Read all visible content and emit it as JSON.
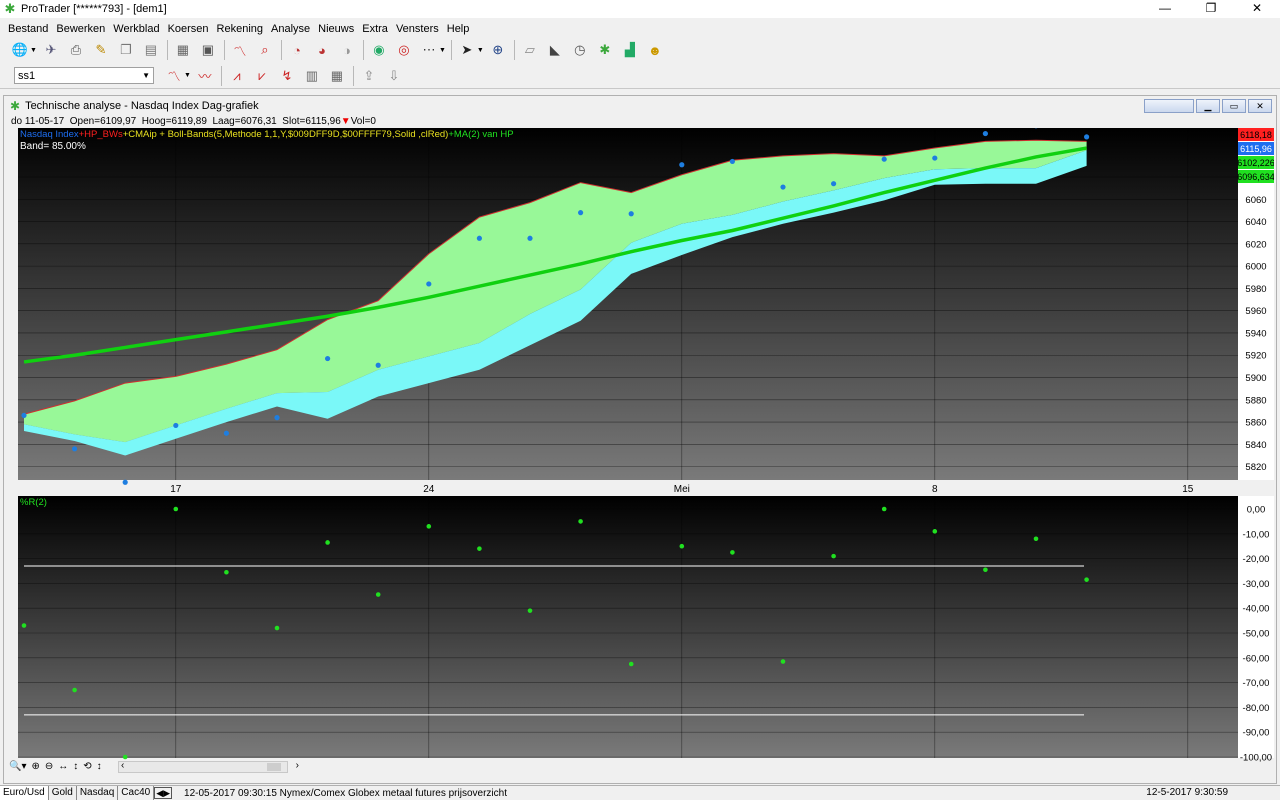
{
  "window": {
    "title": "ProTrader [******793] - [dem1]",
    "controls": [
      "—",
      "❐",
      "✕"
    ]
  },
  "menu": [
    {
      "label": "Bestand"
    },
    {
      "label": "Bewerken"
    },
    {
      "label": "Werkblad"
    },
    {
      "label": "Koersen"
    },
    {
      "label": "Rekening"
    },
    {
      "label": "Analyse"
    },
    {
      "label": "Nieuws"
    },
    {
      "label": "Extra"
    },
    {
      "label": "Vensters"
    },
    {
      "label": "Help"
    }
  ],
  "toolbar": {
    "sheet_value": "ss1"
  },
  "document": {
    "title": "Technische analyse -   Nasdaq Index Dag-grafiek",
    "quote": {
      "date": "do 11-05-17",
      "open": "Open=6109,97",
      "high": "Hoog=6119,89",
      "low": "Laag=6076,31",
      "close": "Slot=6115,96",
      "vol": "Vol=0"
    }
  },
  "colors": {
    "band_upper_fill": "#98f898",
    "band_lower_fill": "#7af8f8",
    "ma_line": "#10d010",
    "price_dot": "#1e7ee0",
    "r_dot": "#20e020",
    "label_red": "#ff2020",
    "label_blue": "#1e6ef0",
    "label_green": "#20e020"
  },
  "legend": {
    "nasdaq": "Nasdaq Index",
    "hp": "+HP_BWs",
    "cmaip": "+CMAip + Boll-Bands(5,Methode 1,1,Y,$009DFF9D,$00FFFF79,Solid     ,clRed)",
    "ma": "+MA(2) van HP",
    "band": "Band= 85.00%"
  },
  "lower_legend": "%R(2)",
  "last_labels": [
    "6118,18",
    "6115,96",
    "6102,226",
    "6096,634"
  ],
  "chart_data": [
    {
      "type": "line",
      "title": "Nasdaq Index Dag-grafiek",
      "x_ticks": [
        "17",
        "24",
        "Mei",
        "8",
        "15"
      ],
      "y_ticks": [
        6080,
        6060,
        6040,
        6020,
        6000,
        5980,
        5960,
        5940,
        5920,
        5900,
        5880,
        5860,
        5840,
        5820
      ],
      "ylim": [
        5808,
        6124
      ],
      "series": [
        {
          "name": "Nasdaq Index",
          "values": [
            5866,
            5836,
            5806,
            5857,
            5850,
            5864,
            5917,
            5911,
            5984,
            6025,
            6025,
            6048,
            6047,
            6091,
            6094,
            6071,
            6074,
            6096,
            6097,
            6119,
            6126,
            6116
          ]
        },
        {
          "name": "HP_BWs",
          "values": [
            5867,
            5879,
            5895,
            5901,
            5912,
            5925,
            5952,
            5969,
            6011,
            6044,
            6057,
            6075,
            6066,
            6082,
            6095,
            6099,
            6101,
            6099,
            6106,
            6112,
            6113,
            6112
          ]
        },
        {
          "name": "CMAip",
          "values": [
            5858,
            5849,
            5842,
            5857,
            5872,
            5886,
            5887,
            5907,
            5919,
            5931,
            5957,
            5979,
            6021,
            6038,
            6046,
            6058,
            6068,
            6079,
            6087,
            6088,
            6088,
            6104
          ]
        },
        {
          "name": "MA(2) van HP",
          "values": [
            5914,
            5920,
            5927,
            5934,
            5941,
            5948,
            5955,
            5963,
            5972,
            5982,
            5992,
            6002,
            6013,
            6023,
            6032,
            6043,
            6054,
            6066,
            6077,
            6088,
            6098,
            6106
          ]
        }
      ]
    },
    {
      "type": "scatter",
      "title": "%R(2)",
      "y_ticks": [
        "0,00",
        "-10,00",
        "-20,00",
        "-30,00",
        "-40,00",
        "-50,00",
        "-60,00",
        "-70,00",
        "-80,00",
        "-90,00",
        "-100,00"
      ],
      "ylim": [
        -100,
        0
      ],
      "reference_lines": [
        -23,
        -83
      ],
      "series": [
        {
          "name": "%R(2)",
          "values": [
            -47,
            -73,
            -100,
            0,
            -25.5,
            -48,
            -13.5,
            -34.5,
            -7,
            -16,
            -41,
            -5,
            -62.5,
            -15,
            -17.5,
            -61.5,
            -19,
            0,
            -9,
            -24.5,
            -12,
            -28.5
          ]
        }
      ]
    }
  ],
  "bottom_controls": [
    "🔍▾",
    "⊕",
    "⊖",
    "↔",
    "↕",
    "⟲",
    "↕",
    "‹",
    "›"
  ],
  "status": {
    "tabs": [
      "Euro/Usd",
      "Gold",
      "Nasdaq",
      "Cac40"
    ],
    "tab_nav": "◀▶",
    "news": "12-05-2017 09:30:15 Nymex/Comex Globex metaal futures prijsoverzicht",
    "clock": "12-5-2017 9:30:59"
  }
}
